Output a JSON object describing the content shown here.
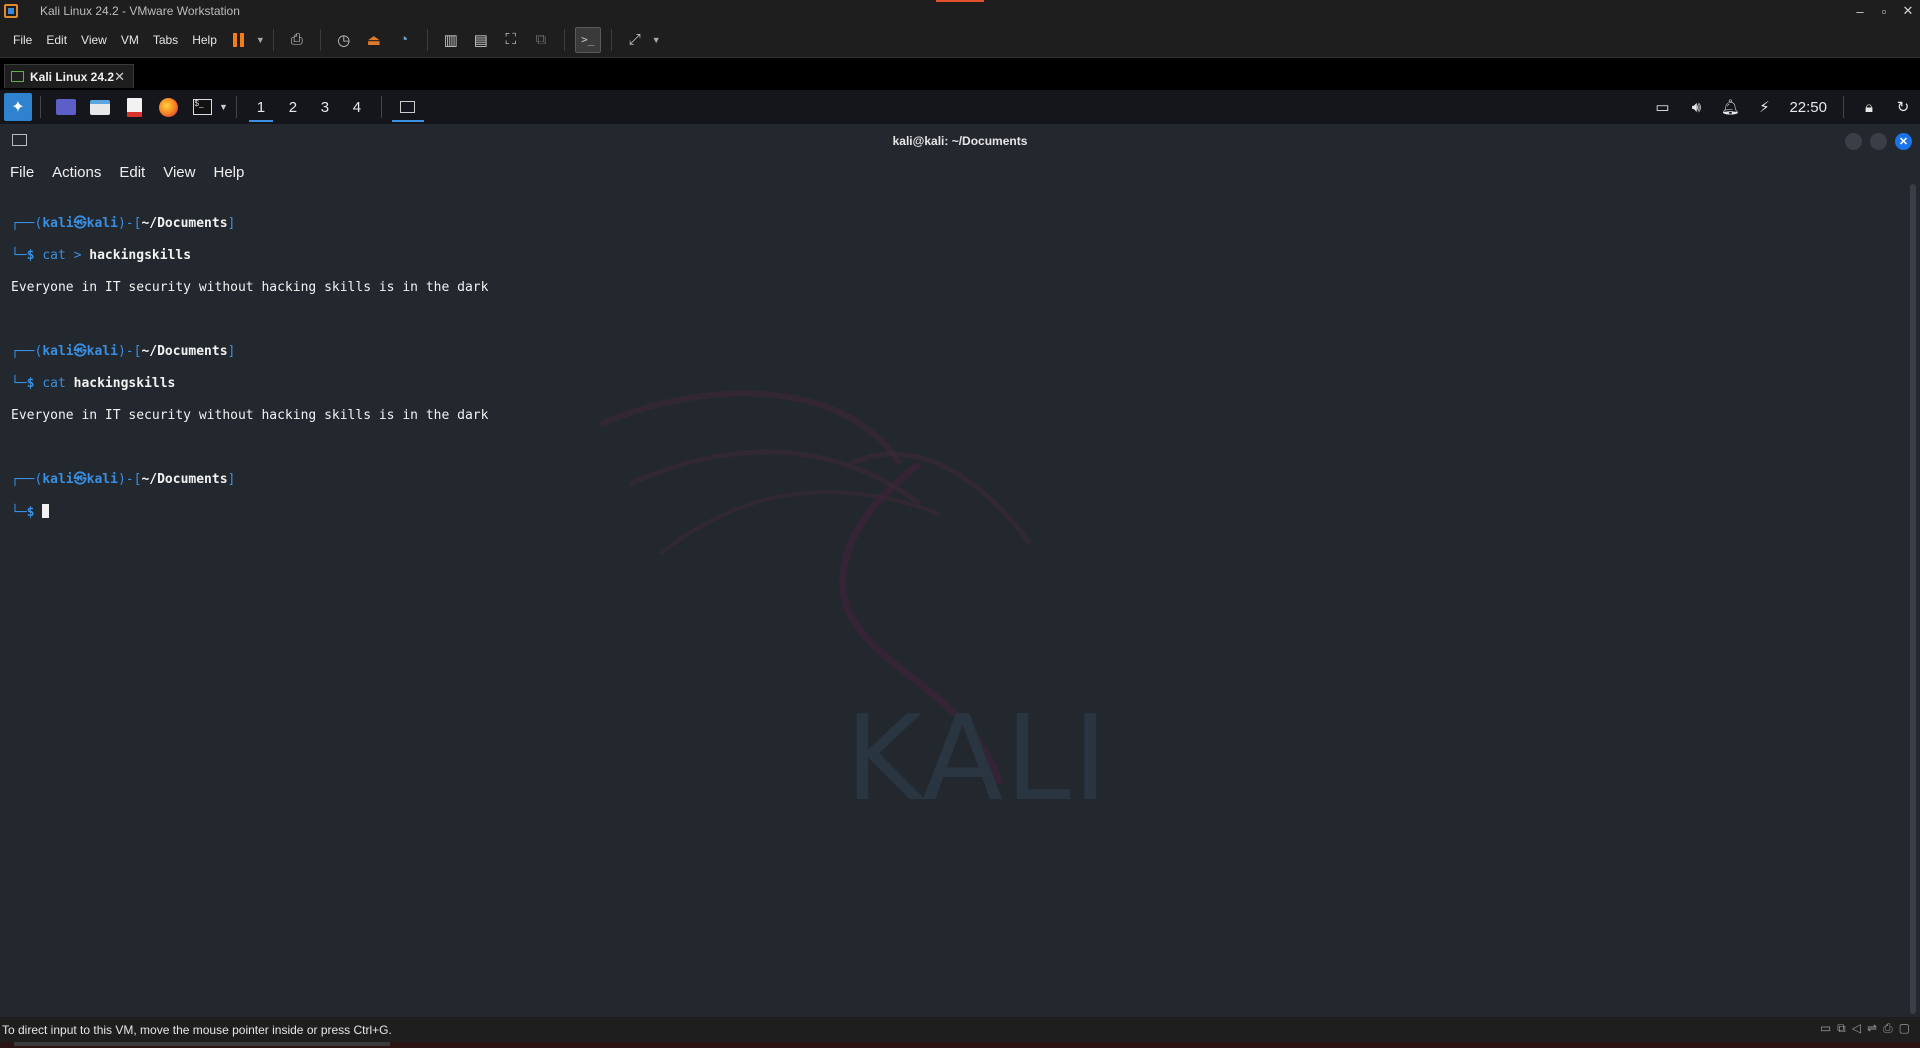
{
  "vmware": {
    "title": "Kali Linux 24.2 - VMware Workstation",
    "menu": [
      "File",
      "Edit",
      "View",
      "VM",
      "Tabs",
      "Help"
    ],
    "tab_label": "Kali Linux 24.2",
    "status_text": "To direct input to this VM, move the mouse pointer inside or press Ctrl+G."
  },
  "panel": {
    "workspaces": [
      "1",
      "2",
      "3",
      "4"
    ],
    "active_workspace": "1",
    "clock": "22:50"
  },
  "terminal": {
    "title": "kali@kali: ~/Documents",
    "menu": [
      "File",
      "Actions",
      "Edit",
      "View",
      "Help"
    ],
    "user": "kali",
    "host": "kali",
    "cwd": "~/Documents",
    "cmd1_pre": "cat > ",
    "cmd1_arg": "hackingskills",
    "out1": "Everyone in IT security without hacking skills is in the dark",
    "cmd2_pre": "cat ",
    "cmd2_arg": "hackingskills",
    "out2": "Everyone in IT security without hacking skills is in the dark"
  },
  "background": {
    "watermark": "KALI"
  },
  "colors": {
    "prompt_blue": "#3a8fe0",
    "terminal_bg": "#23272e",
    "pause_orange": "#f07d1a"
  },
  "icons": {
    "toolbar": [
      "pause-icon",
      "send-keys-icon",
      "snapshot-icon",
      "revert-snapshot-icon",
      "snapshot-manager-icon",
      "library-icon",
      "thumbnail-icon",
      "fullscreen-icon",
      "unity-icon",
      "console-icon",
      "stretch-icon"
    ],
    "panel": [
      "kali-menu-icon",
      "desktop-icon",
      "file-manager-icon",
      "text-editor-icon",
      "firefox-icon",
      "terminal-icon"
    ]
  }
}
